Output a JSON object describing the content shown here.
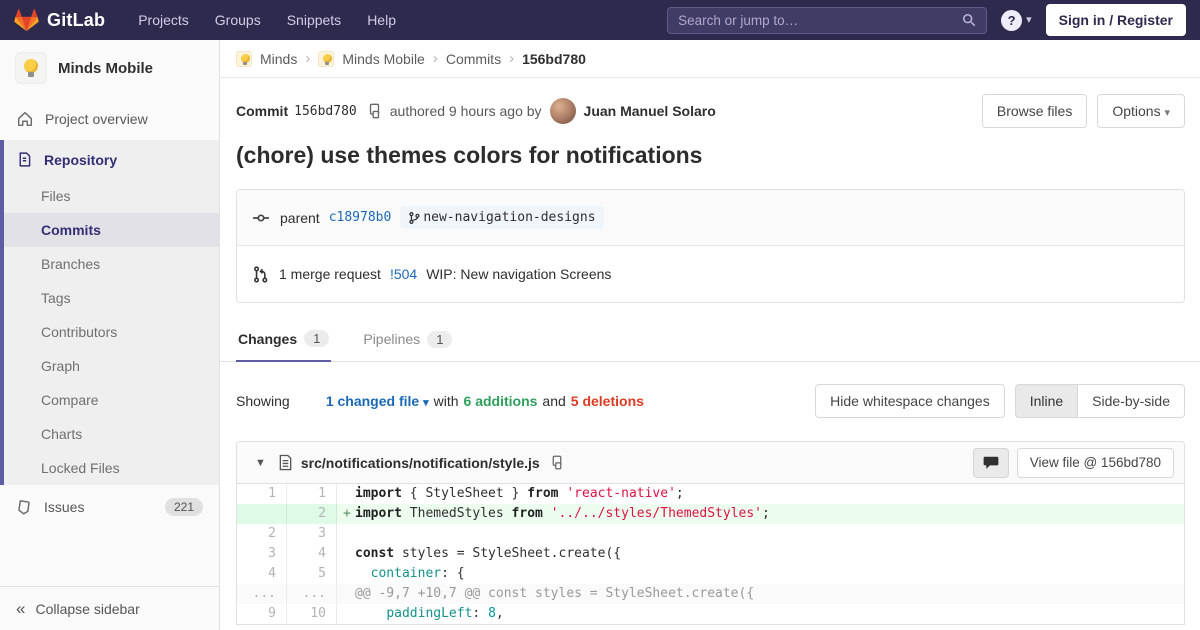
{
  "colors": {
    "navbar": "#2e2a4e",
    "accent": "#605ba5",
    "link": "#1b69b6",
    "additions": "#2e9e5b",
    "deletions": "#db3b21",
    "added_line_bg": "#ecfdf0"
  },
  "navbar": {
    "logo_text": "GitLab",
    "links": [
      "Projects",
      "Groups",
      "Snippets",
      "Help"
    ],
    "search_placeholder": "Search or jump to…",
    "help_label": "?",
    "signin_label": "Sign in / Register"
  },
  "sidebar": {
    "project_name": "Minds Mobile",
    "overview_label": "Project overview",
    "repository_label": "Repository",
    "repo_items": [
      "Files",
      "Commits",
      "Branches",
      "Tags",
      "Contributors",
      "Graph",
      "Compare",
      "Charts",
      "Locked Files"
    ],
    "active_item": "Commits",
    "issues_label": "Issues",
    "issues_count": "221",
    "collapse_label": "Collapse sidebar"
  },
  "breadcrumb": {
    "links": [
      {
        "label": "Minds",
        "avatar": true
      },
      {
        "label": "Minds Mobile",
        "avatar": true
      },
      {
        "label": "Commits",
        "avatar": false
      }
    ],
    "current": "156bd780"
  },
  "commit": {
    "label": "Commit",
    "sha": "156bd780",
    "authored": "authored 9 hours ago by",
    "author": "Juan Manuel Solaro",
    "browse_files_label": "Browse files",
    "options_label": "Options",
    "title": "(chore) use themes colors for notifications",
    "parent_label": "parent",
    "parent_sha": "c18978b0",
    "branch": "new-navigation-designs",
    "mr_text": "1 merge request",
    "mr_ref": "!504",
    "mr_title": "WIP: New navigation Screens"
  },
  "tabs": [
    {
      "label": "Changes",
      "count": "1",
      "active": true
    },
    {
      "label": "Pipelines",
      "count": "1",
      "active": false
    }
  ],
  "summary": {
    "showing": "Showing",
    "changed_file": "1 changed file",
    "with": "with",
    "additions": "6 additions",
    "and": "and",
    "deletions": "5 deletions",
    "hide_whitespace_label": "Hide whitespace changes",
    "inline_label": "Inline",
    "side_by_side_label": "Side-by-side"
  },
  "diff": {
    "file_path": "src/notifications/notification/style.js",
    "view_file_label": "View file @ 156bd780",
    "rows": [
      {
        "old": "1",
        "new": "1",
        "type": "ctx",
        "sign": "",
        "tokens": [
          [
            "import",
            "k"
          ],
          [
            " { StyleSheet } ",
            ""
          ],
          [
            "from",
            "k"
          ],
          [
            " ",
            ""
          ],
          [
            "'react-native'",
            "s"
          ],
          [
            ";",
            ""
          ]
        ]
      },
      {
        "old": "",
        "new": "2",
        "type": "add",
        "sign": "+",
        "tokens": [
          [
            "import",
            "k"
          ],
          [
            " ThemedStyles ",
            ""
          ],
          [
            "from",
            "k"
          ],
          [
            " ",
            ""
          ],
          [
            "'../../styles/ThemedStyles'",
            "s"
          ],
          [
            ";",
            ""
          ]
        ]
      },
      {
        "old": "2",
        "new": "3",
        "type": "ctx",
        "sign": "",
        "tokens": []
      },
      {
        "old": "3",
        "new": "4",
        "type": "ctx",
        "sign": "",
        "tokens": [
          [
            "const",
            "k"
          ],
          [
            " styles = StyleSheet.create({",
            ""
          ]
        ]
      },
      {
        "old": "4",
        "new": "5",
        "type": "ctx",
        "sign": "",
        "tokens": [
          [
            "  ",
            ""
          ],
          [
            "container",
            "na"
          ],
          [
            ": {",
            ""
          ]
        ]
      },
      {
        "old": "...",
        "new": "...",
        "type": "match",
        "sign": "",
        "tokens": [
          [
            "@@ -9,7 +10,7 @@ const styles = StyleSheet.create({",
            ""
          ]
        ]
      },
      {
        "old": "9",
        "new": "10",
        "type": "ctx",
        "sign": "",
        "tokens": [
          [
            "    ",
            ""
          ],
          [
            "paddingLeft",
            "na"
          ],
          [
            ": ",
            ""
          ],
          [
            "8",
            "m"
          ],
          [
            ",",
            ""
          ]
        ]
      }
    ]
  }
}
